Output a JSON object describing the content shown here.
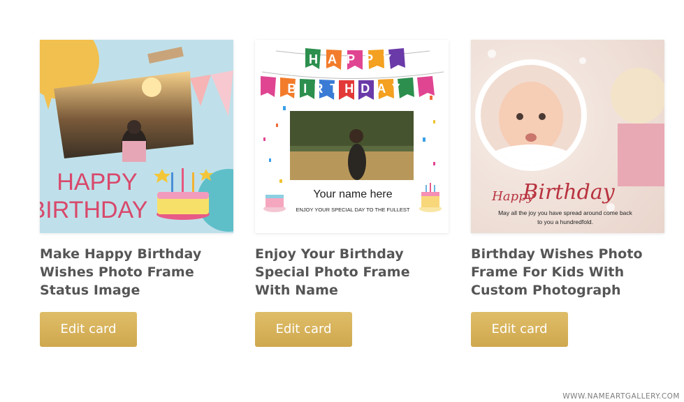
{
  "cards": [
    {
      "title": "Make Happy Birthday Wishes Photo Frame Status Image",
      "button_label": "Edit card",
      "image_text": {
        "line1": "HAPPY",
        "line2": "BIRTHDAY"
      }
    },
    {
      "title": "Enjoy Your Birthday Special Photo Frame With Name",
      "button_label": "Edit card",
      "image_text": {
        "banner_line1": "HAPPY",
        "banner_line2": "BIRTHDAY",
        "name": "Your name here",
        "tagline": "ENJOY YOUR SPECIAL DAY TO THE FULLEST"
      }
    },
    {
      "title": "Birthday Wishes Photo Frame For Kids With Custom Photograph",
      "button_label": "Edit card",
      "image_text": {
        "happy": "Happy",
        "birthday": "Birthday",
        "message_line1": "May all the joy you have spread around come back",
        "message_line2": "to you a hundredfold."
      }
    }
  ],
  "watermark": "WWW.NAMEARTGALLERY.COM",
  "colors": {
    "button": "#d4af5a",
    "title": "#555555",
    "accent_pink": "#d8486b"
  }
}
